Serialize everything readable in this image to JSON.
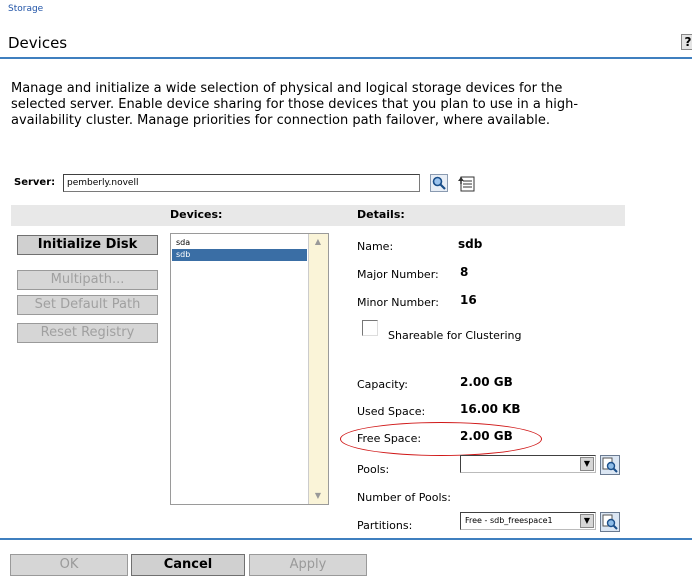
{
  "breadcrumb": "Storage",
  "page_title": "Devices",
  "help_label": "?",
  "description": "Manage and initialize a wide selection of physical and logical storage devices for the selected server. Enable device sharing for those devices that you plan to use in a high-availability cluster. Manage priorities for connection path failover, where available.",
  "server": {
    "label": "Server:",
    "value": "pemberly.novell"
  },
  "columns": {
    "devices": "Devices:",
    "details": "Details:"
  },
  "actions": {
    "initialize": "Initialize Disk",
    "multipath": "Multipath...",
    "set_default_path": "Set Default Path",
    "reset_registry": "Reset Registry"
  },
  "devices": [
    "sda",
    "sdb"
  ],
  "details": {
    "name_label": "Name:",
    "name_value": "sdb",
    "major_label": "Major Number:",
    "major_value": "8",
    "minor_label": "Minor Number:",
    "minor_value": "16",
    "shareable_label": "Shareable for Clustering",
    "capacity_label": "Capacity:",
    "capacity_value": "2.00 GB",
    "used_label": "Used Space:",
    "used_value": "16.00 KB",
    "free_label": "Free Space:",
    "free_value": "2.00 GB",
    "pools_label": "Pools:",
    "pools_value": "",
    "num_pools_label": "Number of Pools:",
    "partitions_label": "Partitions:",
    "partitions_value": "Free - sdb_freespace1"
  },
  "footer": {
    "ok": "OK",
    "cancel": "Cancel",
    "apply": "Apply"
  },
  "colors": {
    "accent": "#3f7fbf",
    "selection": "#3a6ea5",
    "annotation": "#d01818"
  }
}
